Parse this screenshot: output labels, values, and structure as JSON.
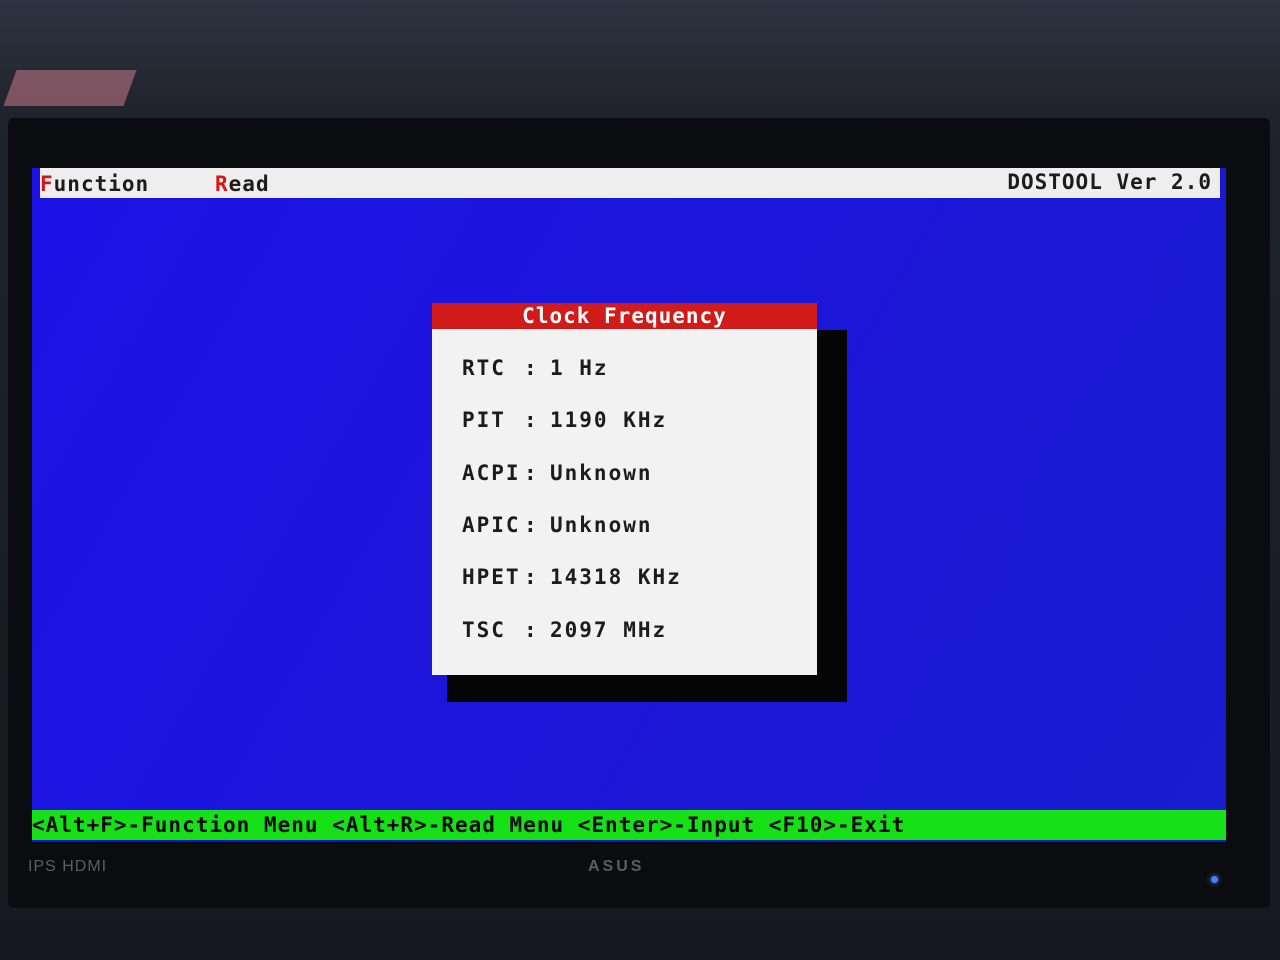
{
  "window": {
    "app_title": "DOSTOOL Ver 2.0"
  },
  "menubar": {
    "function": {
      "hotkey": "F",
      "rest": "unction"
    },
    "read": {
      "hotkey": "R",
      "rest": "ead"
    }
  },
  "dialog": {
    "title": "Clock Frequency",
    "rows": [
      {
        "label": "RTC",
        "sep": ":",
        "value": "1 Hz"
      },
      {
        "label": "PIT",
        "sep": ":",
        "value": "1190 KHz"
      },
      {
        "label": "ACPI",
        "sep": ":",
        "value": "Unknown"
      },
      {
        "label": "APIC",
        "sep": ":",
        "value": "Unknown"
      },
      {
        "label": "HPET",
        "sep": ":",
        "value": "14318 KHz"
      },
      {
        "label": "TSC",
        "sep": ":",
        "value": "2097 MHz"
      }
    ]
  },
  "statusbar": {
    "function_menu": "<Alt+F>-Function Menu",
    "read_menu": "<Alt+R>-Read Menu",
    "input": "<Enter>-Input",
    "exit": "<F10>-Exit"
  },
  "bezel": {
    "left_label": "IPS HDMI",
    "brand": "ASUS"
  },
  "colors": {
    "screen_bg": "#1d12e6",
    "menubar_bg": "#eeeeee",
    "hotkey": "#d01818",
    "dialog_title_bg": "#d11a1a",
    "dialog_bg": "#f2f2f2",
    "statusbar_bg": "#16e016"
  }
}
